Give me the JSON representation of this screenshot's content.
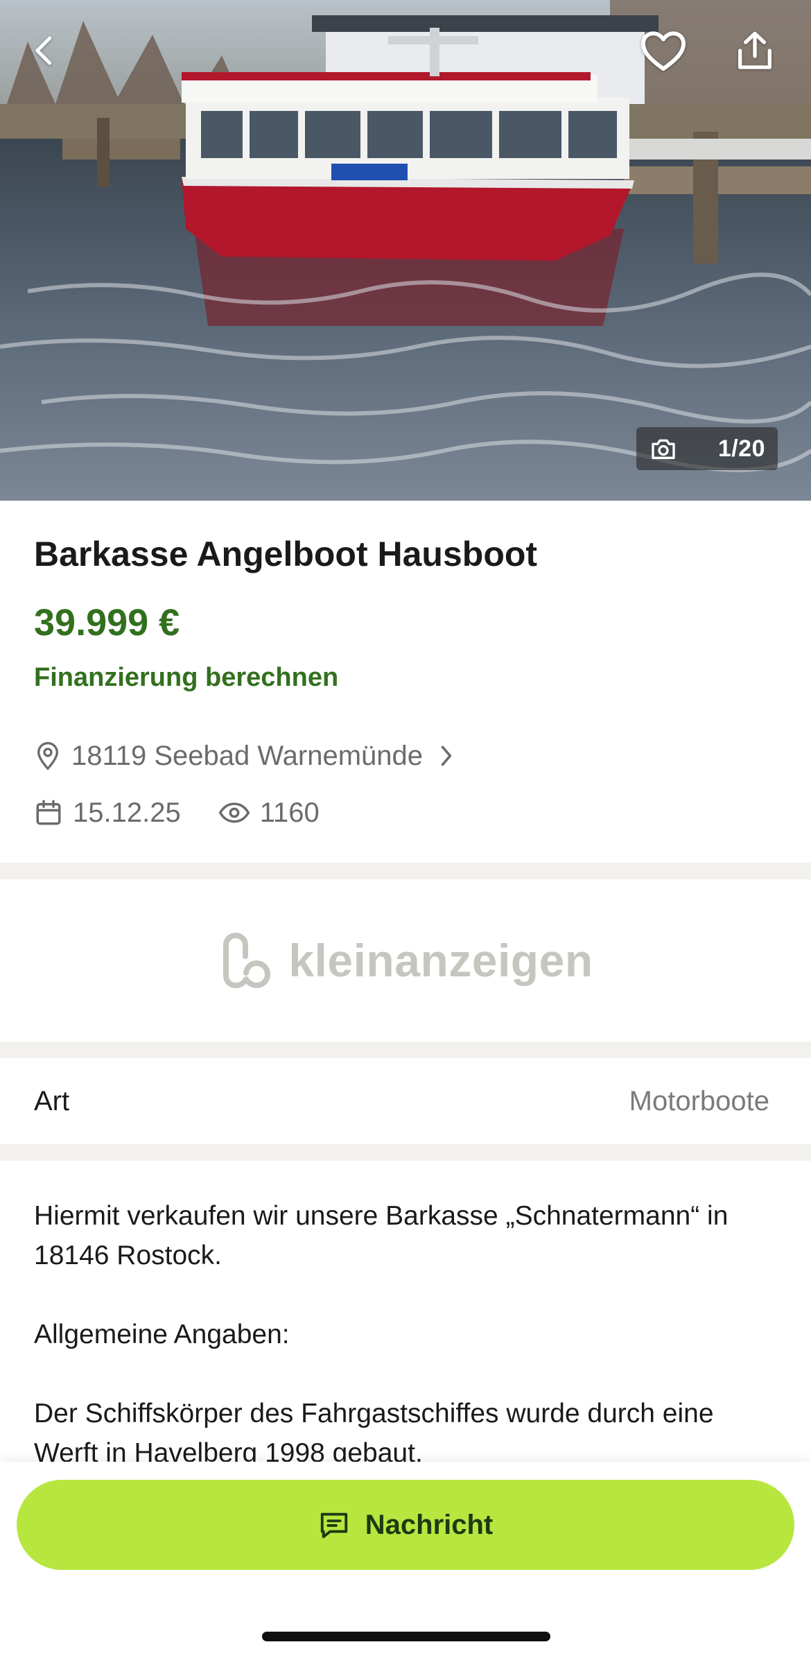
{
  "header": {
    "back_icon": "chevron-left-icon",
    "favorite_icon": "heart-icon",
    "share_icon": "share-icon"
  },
  "gallery": {
    "camera_icon": "camera-icon",
    "counter": "1/20"
  },
  "listing": {
    "title": "Barkasse Angelboot Hausboot",
    "price": "39.999 €",
    "finance_link": "Finanzierung berechnen",
    "location": "18119 Seebad Warnemünde",
    "date": "15.12.25",
    "views": "1160"
  },
  "brand": {
    "name": "kleinanzeigen"
  },
  "attributes": [
    {
      "key": "Art",
      "value": "Motorboote"
    }
  ],
  "description": [
    "Hiermit verkaufen wir unsere Barkasse „Schnatermann“ in 18146 Rostock.",
    "Allgemeine Angaben:",
    "Der Schiffskörper des Fahrgastschiffes wurde durch eine Werft in Havelberg 1998 gebaut."
  ],
  "actions": {
    "message_label": "Nachricht"
  },
  "colors": {
    "price_green": "#32701e",
    "cta_lime": "#b7e63f",
    "separator": "#f2f1ee"
  }
}
